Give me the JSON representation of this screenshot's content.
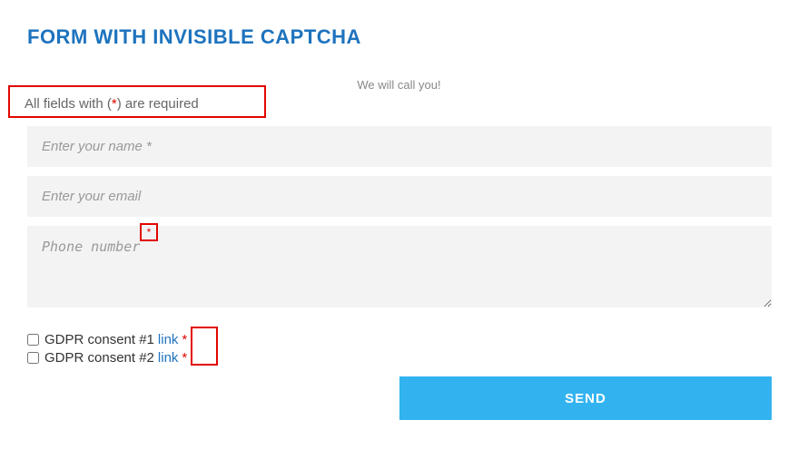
{
  "header": {
    "title": "FORM WITH INVISIBLE CAPTCHA",
    "subtitle": "We will call you!"
  },
  "required_note": {
    "prefix": "All fields with ( ",
    "star": "*",
    "suffix": " ) are required"
  },
  "fields": {
    "name_placeholder": "Enter your name *",
    "email_placeholder": "Enter your email",
    "phone_placeholder": "Phone number",
    "phone_star": "*"
  },
  "consents": [
    {
      "label": "GDPR consent #1",
      "link": "link",
      "required": "*"
    },
    {
      "label": "GDPR consent #2",
      "link": "link",
      "required": "*"
    }
  ],
  "button": {
    "send": "SEND"
  },
  "colors": {
    "accent": "#1e73be",
    "highlight": "#e10600",
    "button": "#32b3ef"
  }
}
